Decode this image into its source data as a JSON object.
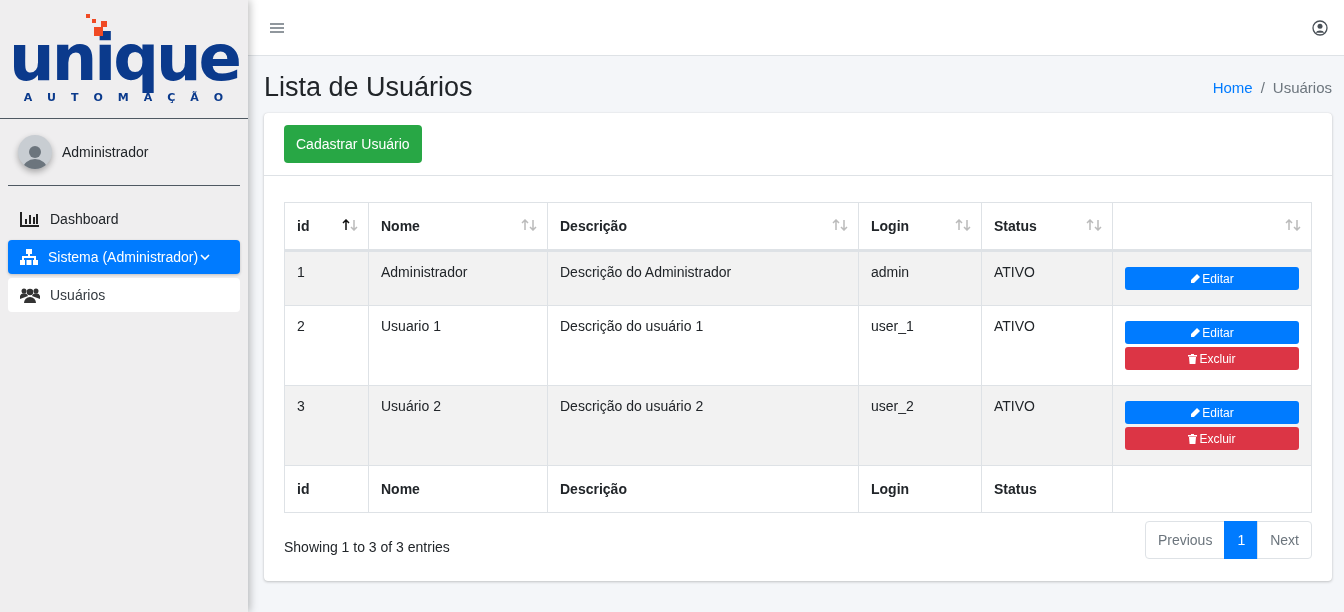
{
  "logo": {
    "name": "unique",
    "tagline": "AUTOMAÇÃO"
  },
  "user": {
    "name": "Administrador"
  },
  "nav": [
    {
      "label": "Dashboard",
      "selected": false
    },
    {
      "label": "Sistema (Administrador)",
      "selected": true,
      "expanded": true,
      "children": [
        {
          "label": "Usuários",
          "selected": true
        }
      ]
    }
  ],
  "page": {
    "title": "Lista de Usuários",
    "breadcrumb": [
      {
        "label": "Home",
        "kind": "link"
      },
      {
        "label": "/",
        "kind": "sep"
      },
      {
        "label": "Usuários",
        "kind": "current"
      }
    ]
  },
  "add_button": "Cadastrar Usuário",
  "table": {
    "columns": [
      {
        "label": "id",
        "sorted": true
      },
      {
        "label": "Nome",
        "sorted": false
      },
      {
        "label": "Descrição",
        "sorted": false
      },
      {
        "label": "Login",
        "sorted": false
      },
      {
        "label": "Status",
        "sorted": false
      },
      {
        "sorted": false
      }
    ],
    "rows": [
      {
        "cells": [
          "1",
          "Administrador",
          "Descrição do Administrador",
          "admin",
          "ATIVO"
        ],
        "actions": [
          {
            "kind": "edit",
            "label": "Editar"
          }
        ]
      },
      {
        "cells": [
          "2",
          "Usuario 1",
          "Descrição do usuário 1",
          "user_1",
          "ATIVO"
        ],
        "actions": [
          {
            "kind": "edit",
            "label": "Editar"
          },
          {
            "kind": "delete",
            "label": "Excluir"
          }
        ]
      },
      {
        "cells": [
          "3",
          "Usuário 2",
          "Descrição do usuário 2",
          "user_2",
          "ATIVO"
        ],
        "actions": [
          {
            "kind": "edit",
            "label": "Editar"
          },
          {
            "kind": "delete",
            "label": "Excluir"
          }
        ]
      }
    ],
    "footer": [
      "id",
      "Nome",
      "Descrição",
      "Login",
      "Status"
    ]
  },
  "info": "Showing 1 to 3 of 3 entries",
  "pagination": [
    {
      "label": "Previous",
      "selected": false
    },
    {
      "label": "1",
      "selected": true
    },
    {
      "label": "Next",
      "selected": false
    }
  ]
}
